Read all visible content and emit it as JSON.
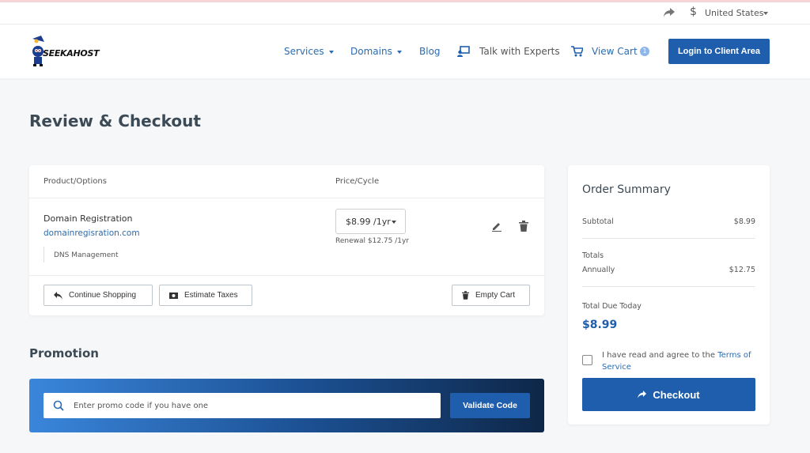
{
  "utility": {
    "country": "United States",
    "currency_symbol": "$"
  },
  "header": {
    "logo_text": "SEEKAHOST",
    "nav": {
      "services": "Services",
      "domains": "Domains",
      "blog": "Blog",
      "experts": "Talk with Experts",
      "cart": "View Cart",
      "cart_count": "1"
    },
    "login_label": "Login to Client Area"
  },
  "page": {
    "title": "Review & Checkout"
  },
  "cart": {
    "columns": {
      "product": "Product/Options",
      "price": "Price/Cycle"
    },
    "item": {
      "name": "Domain Registration",
      "domain": "domainregisration.com",
      "option": "DNS Management",
      "cycle": "$8.99 /1yr",
      "renewal": "Renewal $12.75 /1yr"
    },
    "buttons": {
      "continue": "Continue Shopping",
      "taxes": "Estimate Taxes",
      "empty": "Empty Cart"
    }
  },
  "promotion": {
    "title": "Promotion",
    "placeholder": "Enter promo code if you have one",
    "validate_label": "Validate Code"
  },
  "summary": {
    "title": "Order Summary",
    "subtotal_label": "Subtotal",
    "subtotal_value": "$8.99",
    "totals_label": "Totals",
    "annually_label": "Annually",
    "annually_value": "$12.75",
    "due_label": "Total Due Today",
    "due_value": "$8.99",
    "agree_prefix": "I have read and agree to the ",
    "agree_link": "Terms of Service",
    "checkout_label": "Checkout"
  },
  "colors": {
    "brand": "#1f5eac",
    "link": "#2b6cb0"
  },
  "icons": [
    "share-icon",
    "dollar-icon",
    "logo-icon",
    "experts-icon",
    "cart-icon",
    "edit-icon",
    "trash-icon",
    "reply-icon",
    "money-icon",
    "search-icon",
    "arrow-icon"
  ]
}
